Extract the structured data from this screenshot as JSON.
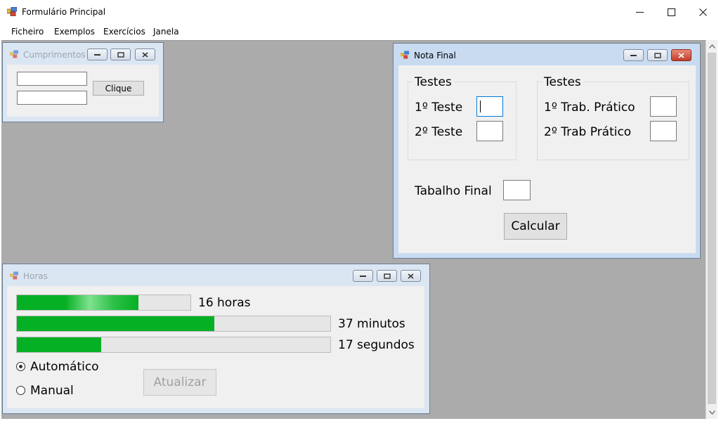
{
  "app": {
    "title": "Formulário Principal"
  },
  "menu": {
    "items": [
      "Ficheiro",
      "Exemplos",
      "Exercícios",
      "Janela"
    ]
  },
  "cumprimentos": {
    "title": "Cumprimentos",
    "input1_value": "",
    "input2_value": "",
    "button_label": "Clique"
  },
  "nota_final": {
    "title": "Nota Final",
    "group1_title": "Testes",
    "group2_title": "Testes",
    "teste1_label": "1º Teste",
    "teste2_label": "2º Teste",
    "trab1_label": "1º Trab. Prático",
    "trab2_label": "2º Trab Prático",
    "final_label": "Tabalho Final",
    "calc_label": "Calcular"
  },
  "horas": {
    "title": "Horas",
    "bars": [
      {
        "label": "16 horas",
        "fraction": 0.7
      },
      {
        "label": "37 minutos",
        "fraction": 0.63
      },
      {
        "label": "17 segundos",
        "fraction": 0.27
      }
    ],
    "radio_auto": "Automático",
    "radio_manual": "Manual",
    "selected": "auto",
    "update_label": "Atualizar"
  },
  "colors": {
    "progress": "#06b025",
    "mdi_background": "#ababab",
    "close_active": "#c13f2b"
  }
}
